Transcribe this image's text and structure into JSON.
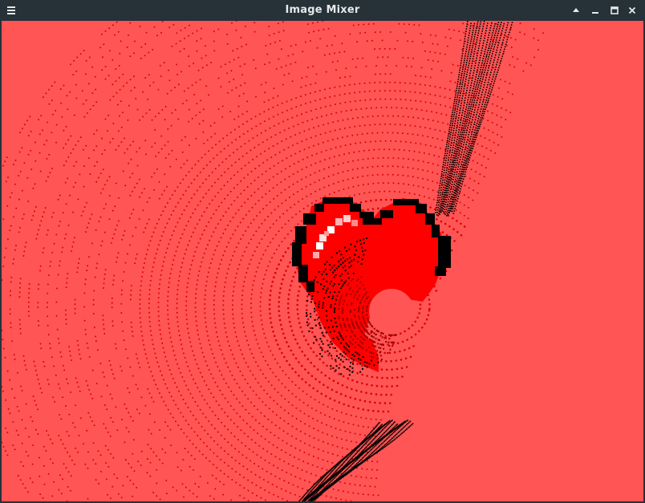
{
  "window": {
    "title": "Image Mixer"
  },
  "titlebar": {
    "menu_icon": "hamburger-menu-icon",
    "buttons": [
      {
        "name": "keep-above-button",
        "icon": "triangle-up-icon"
      },
      {
        "name": "minimize-button",
        "icon": "minimize-icon"
      },
      {
        "name": "maximize-button",
        "icon": "maximize-icon"
      },
      {
        "name": "close-button",
        "icon": "close-x-icon"
      }
    ]
  },
  "canvas": {
    "background_color": "#ff5555",
    "pattern_color": "#dd0000",
    "heart_color": "#ff0000",
    "outline_color": "#000000",
    "highlight_color": "#ffffff"
  }
}
